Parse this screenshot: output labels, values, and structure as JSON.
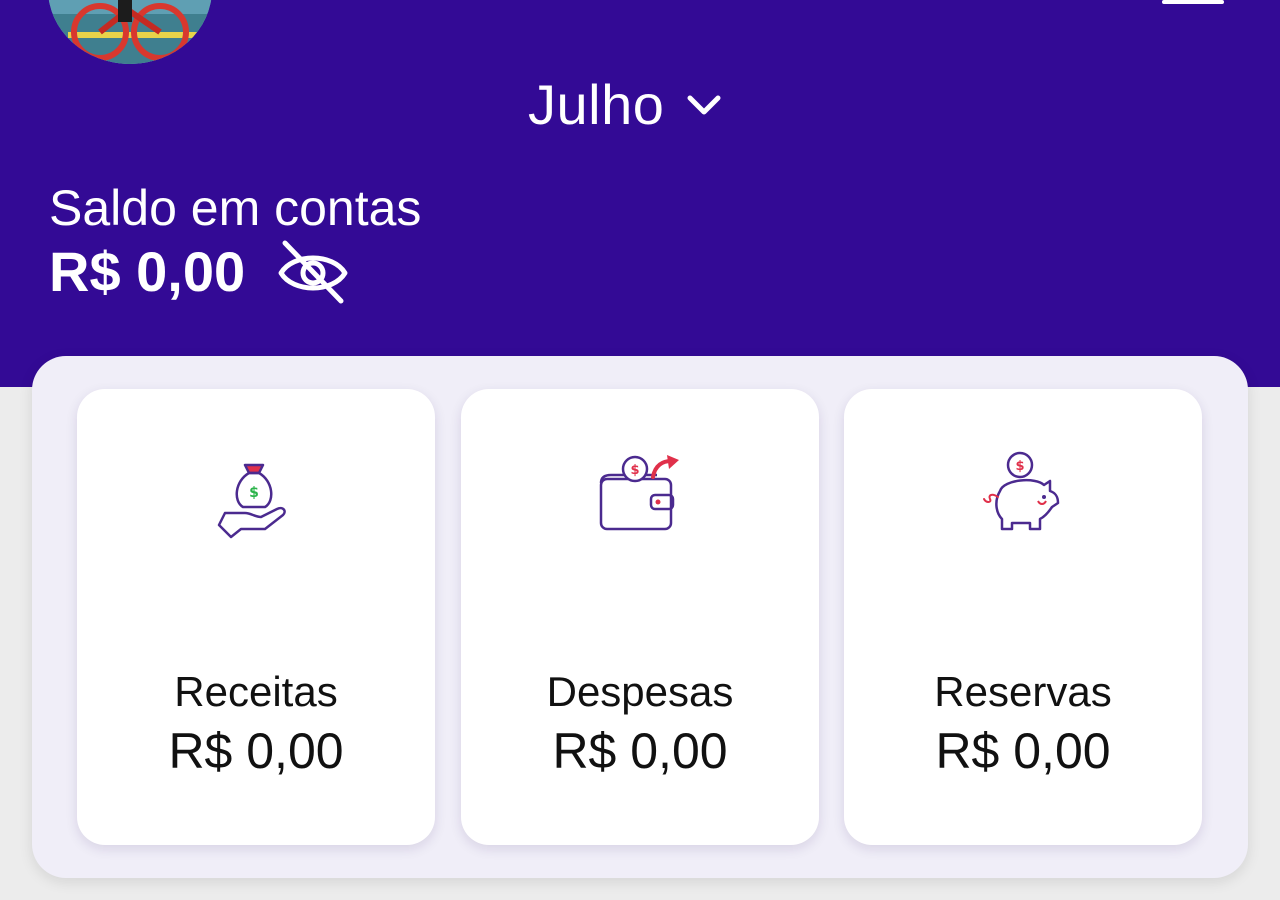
{
  "header": {
    "month": "Julho",
    "balance_label": "Saldo em contas",
    "balance_value": "R$ 0,00",
    "icons": [
      "avatar",
      "menu-icon",
      "chevron-down-icon",
      "eye-off-icon"
    ]
  },
  "cards": [
    {
      "title": "Receitas",
      "value": "R$ 0,00",
      "icon": "money-bag-hand-icon"
    },
    {
      "title": "Despesas",
      "value": "R$ 0,00",
      "icon": "wallet-icon"
    },
    {
      "title": "Reservas",
      "value": "R$ 0,00",
      "icon": "piggy-bank-icon"
    }
  ],
  "colors": {
    "primary": "#330a95",
    "panel": "#f0eef8",
    "card": "#ffffff",
    "icon_stroke": "#4b2a8f",
    "accent_green": "#2bb34a",
    "accent_red": "#e0304a"
  }
}
